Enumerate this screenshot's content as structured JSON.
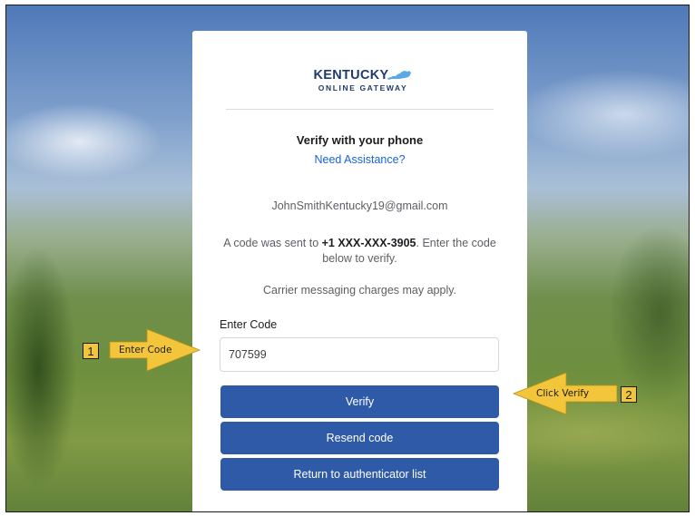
{
  "logo": {
    "main": "KENTUCKY",
    "sub": "ONLINE GATEWAY",
    "state_shape_color": "#5aa9e6",
    "brand_color": "#1f3b6e"
  },
  "verify": {
    "heading": "Verify with your phone",
    "assistance_link": "Need Assistance?",
    "email": "JohnSmithKentucky19@gmail.com",
    "code_sent_prefix": "A code was sent to ",
    "phone": "+1 XXX-XXX-3905",
    "code_sent_suffix": ". Enter the code below to verify.",
    "carrier_note": "Carrier messaging charges may apply.",
    "code_label": "Enter Code",
    "code_value": "707599",
    "buttons": {
      "verify": "Verify",
      "resend": "Resend code",
      "return": "Return to authenticator list"
    },
    "button_color": "#2e5aa8"
  },
  "callouts": [
    {
      "number": "1",
      "text": "Enter Code"
    },
    {
      "number": "2",
      "text": "Click Verify"
    }
  ],
  "callout_color": "#f3c53a"
}
